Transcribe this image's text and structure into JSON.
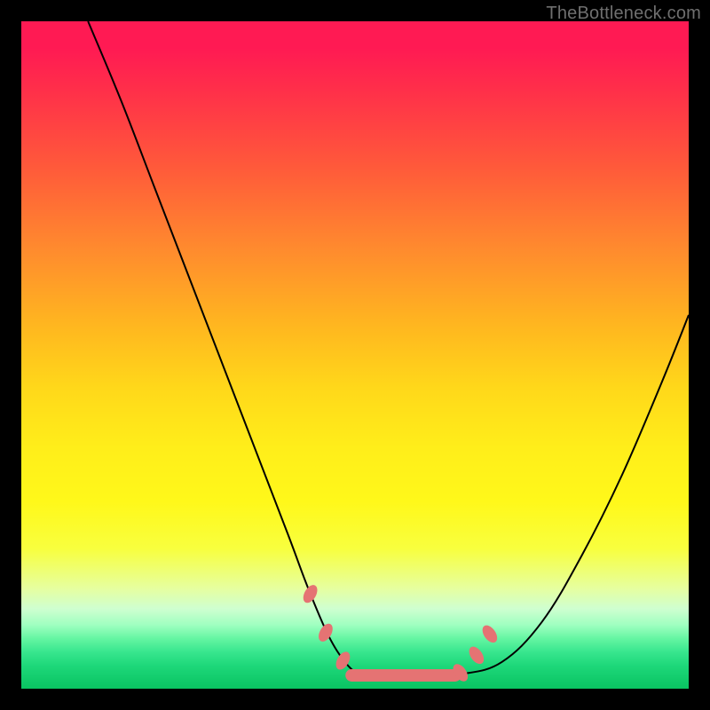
{
  "watermark": "TheBottleneck.com",
  "chart_data": {
    "type": "line",
    "title": "",
    "xlabel": "",
    "ylabel": "",
    "xlim": [
      0,
      100
    ],
    "ylim": [
      0,
      100
    ],
    "grid": false,
    "legend": false,
    "series": [
      {
        "name": "curve",
        "color": "#000000",
        "stroke_width": 2,
        "x": [
          10,
          15,
          20,
          25,
          30,
          35,
          40,
          43,
          46,
          48.5,
          50.5,
          52,
          55,
          60,
          66,
          72,
          78,
          84,
          90,
          96,
          100
        ],
        "y": [
          100,
          88,
          75,
          62,
          49,
          36,
          23,
          15,
          8,
          4,
          2.2,
          2,
          2,
          2,
          2.2,
          4,
          10,
          20,
          32,
          46,
          56
        ]
      },
      {
        "name": "markers",
        "color": "#e57373",
        "type": "scatter",
        "x": [
          43.3,
          45.6,
          48.2,
          65.8,
          68.2,
          70.2
        ],
        "y": [
          14.2,
          8.4,
          4.2,
          2.4,
          5.0,
          8.2
        ]
      },
      {
        "name": "floor-band",
        "color": "#e57373",
        "type": "bar",
        "x_start": 49.5,
        "x_end": 65.0,
        "y": 2.0
      }
    ],
    "background_gradient": {
      "direction": "vertical",
      "stops": [
        {
          "pos": 0.0,
          "color": "#ff1a53"
        },
        {
          "pos": 0.3,
          "color": "#ff8a2e"
        },
        {
          "pos": 0.55,
          "color": "#ffd81a"
        },
        {
          "pos": 0.8,
          "color": "#f8ff3e"
        },
        {
          "pos": 0.92,
          "color": "#64f5a2"
        },
        {
          "pos": 1.0,
          "color": "#0ac462"
        }
      ]
    }
  }
}
